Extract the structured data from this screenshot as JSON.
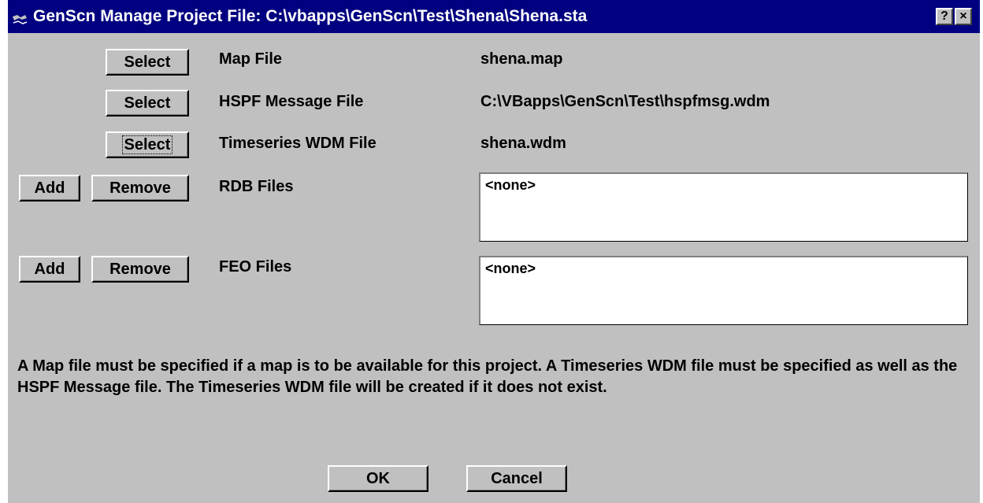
{
  "window": {
    "title": "GenScn Manage Project File: C:\\vbapps\\GenScn\\Test\\Shena\\Shena.sta",
    "help_label": "?",
    "close_label": "×"
  },
  "map_file": {
    "button_label": "Select",
    "label": "Map File",
    "value": "shena.map"
  },
  "hspf_file": {
    "button_label": "Select",
    "label": "HSPF Message File",
    "value": "C:\\VBapps\\GenScn\\Test\\hspfmsg.wdm"
  },
  "wdm_file": {
    "button_label": "Select",
    "label": "Timeseries WDM File",
    "value": "shena.wdm"
  },
  "rdb_files": {
    "add_label": "Add",
    "remove_label": "Remove",
    "label": "RDB Files",
    "items": [
      "<none>"
    ]
  },
  "feo_files": {
    "add_label": "Add",
    "remove_label": "Remove",
    "label": "FEO Files",
    "items": [
      "<none>"
    ]
  },
  "note": "A Map file must be specified if a map is to be available for this project. A Timeseries WDM file must be specified as well as the HSPF Message file.  The Timeseries WDM file will be created if it does not exist.",
  "footer": {
    "ok_label": "OK",
    "cancel_label": "Cancel"
  },
  "icons": {
    "app": "app-icon",
    "help": "help-icon",
    "close": "close-icon"
  }
}
